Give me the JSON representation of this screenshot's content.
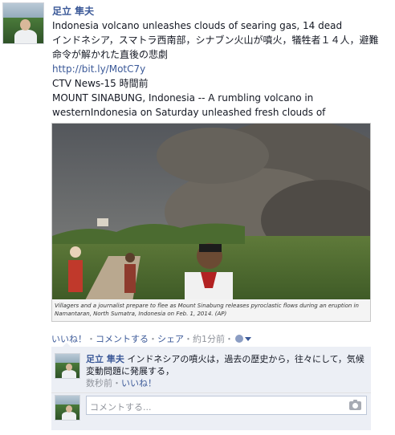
{
  "post": {
    "author": "足立 隼夫",
    "headline_en": "Indonesia volcano unleashes clouds of searing gas, 14 dead",
    "headline_ja": "インドネシア，スマトラ西南部，シナブン火山が噴火，犠牲者１４人，避難命令が解かれた直後の悲劇",
    "link": "http://bit.ly/MotC7y",
    "source": "CTV News-15 時間前",
    "excerpt": "MOUNT SINABUNG, Indonesia -- A rumbling volcano in westernIndonesia on Saturday unleashed fresh clouds of",
    "photo_caption": "Villagers and a journalist prepare to flee as Mount Sinabung releases pyroclastic flows during an eruption in Namantaran, North Sumatra, Indonesia on Feb. 1, 2014. (AP)"
  },
  "actions": {
    "like": "いいね！",
    "comment": "コメントする",
    "share": "シェア",
    "separator": "・",
    "timestamp": "約1分前",
    "audience_icon": "globe-icon"
  },
  "comment": {
    "author": "足立 隼夫",
    "text": "インドネシアの噴火は，過去の歴史から，往々にして，気候変動問題に発展する，",
    "time": "数秒前",
    "like": "いいね！"
  },
  "reply": {
    "placeholder": "コメントする...",
    "camera_icon": "camera-icon"
  },
  "colors": {
    "link": "#3b5998",
    "comment_bg": "#eceff5",
    "muted": "#90949c"
  }
}
